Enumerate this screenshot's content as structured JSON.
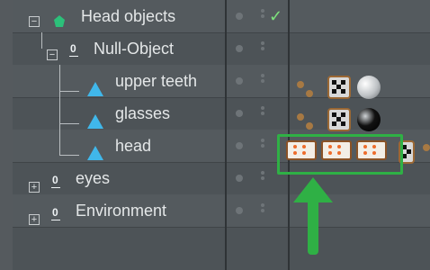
{
  "rows": [
    {
      "label": "Head objects",
      "icon": "polygon-object-icon"
    },
    {
      "label": "Null-Object",
      "icon": "null-object-icon"
    },
    {
      "label": "upper teeth",
      "icon": "polygon-object-icon"
    },
    {
      "label": "glasses",
      "icon": "polygon-object-icon"
    },
    {
      "label": "head",
      "icon": "polygon-object-icon"
    },
    {
      "label": "eyes",
      "icon": "null-object-icon"
    },
    {
      "label": "Environment",
      "icon": "null-object-icon"
    }
  ],
  "null_icon_glyph": "0",
  "checkmark": "✓",
  "highlight_color": "#2fb045"
}
